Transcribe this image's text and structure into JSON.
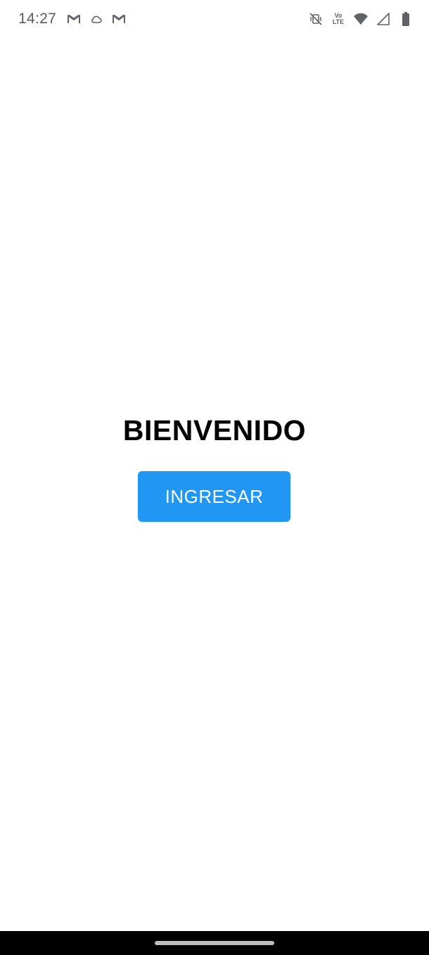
{
  "status_bar": {
    "time": "14:27",
    "left_icons": [
      "gmail-icon",
      "cloud-icon",
      "gmail-icon"
    ],
    "volte_top": "Vo",
    "volte_bottom": "LTE",
    "right_icons": [
      "vibrate-off-icon",
      "volte-icon",
      "wifi-icon",
      "signal-icon",
      "battery-icon"
    ]
  },
  "main": {
    "title": "BIENVENIDO",
    "button_label": "INGRESAR"
  },
  "colors": {
    "accent": "#2196f3",
    "title": "#000000",
    "nav_bar": "#000000"
  }
}
